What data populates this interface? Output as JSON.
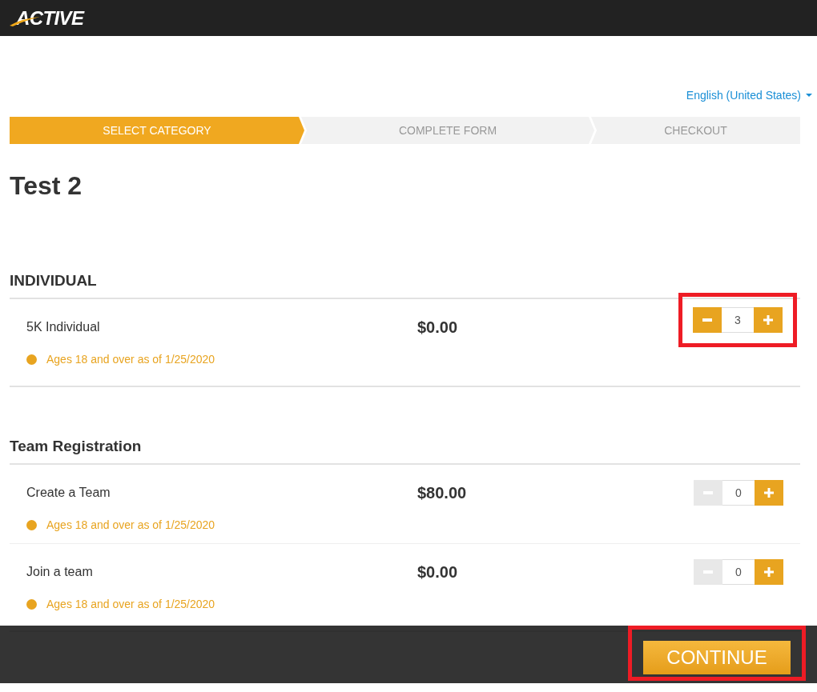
{
  "header": {
    "logo": "ACTIVE"
  },
  "language": {
    "label": "English (United States)"
  },
  "steps": [
    {
      "label": "SELECT CATEGORY",
      "selected": true
    },
    {
      "label": "COMPLETE FORM",
      "selected": false
    },
    {
      "label": "CHECKOUT",
      "selected": false
    }
  ],
  "title": "Test 2",
  "sections": [
    {
      "heading": "INDIVIDUAL",
      "items": [
        {
          "name": "5K Individual",
          "price": "$0.00",
          "quantity": "3",
          "minus_disabled": false,
          "highlighted": true,
          "eligibility": "Ages 18 and over as of 1/25/2020"
        }
      ]
    },
    {
      "heading": "Team Registration",
      "items": [
        {
          "name": "Create a Team",
          "price": "$80.00",
          "quantity": "0",
          "minus_disabled": true,
          "highlighted": false,
          "eligibility": "Ages 18 and over as of 1/25/2020"
        },
        {
          "name": "Join a team",
          "price": "$0.00",
          "quantity": "0",
          "minus_disabled": true,
          "highlighted": false,
          "eligibility": "Ages 18 and over as of 1/25/2020"
        }
      ]
    }
  ],
  "footer": {
    "button": "CONTINUE",
    "highlighted": true
  }
}
